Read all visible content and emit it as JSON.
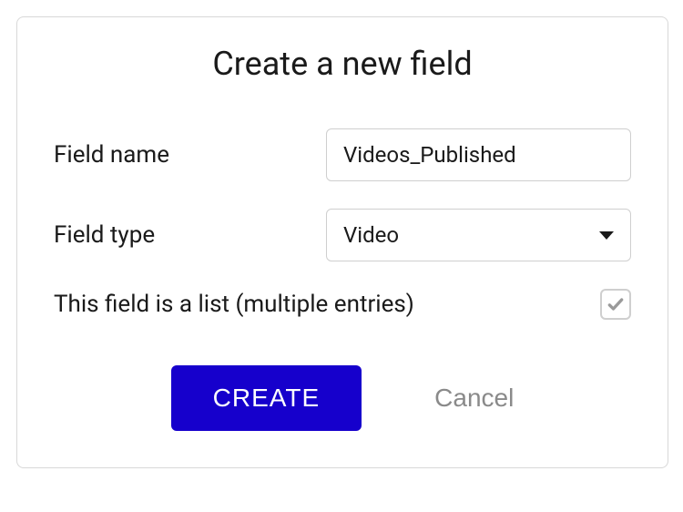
{
  "dialog": {
    "title": "Create a new field",
    "field_name_label": "Field name",
    "field_name_value": "Videos_Published",
    "field_type_label": "Field type",
    "field_type_value": "Video",
    "list_checkbox_label": "This field is a list (multiple entries)",
    "list_checkbox_checked": true,
    "create_button": "CREATE",
    "cancel_button": "Cancel"
  }
}
